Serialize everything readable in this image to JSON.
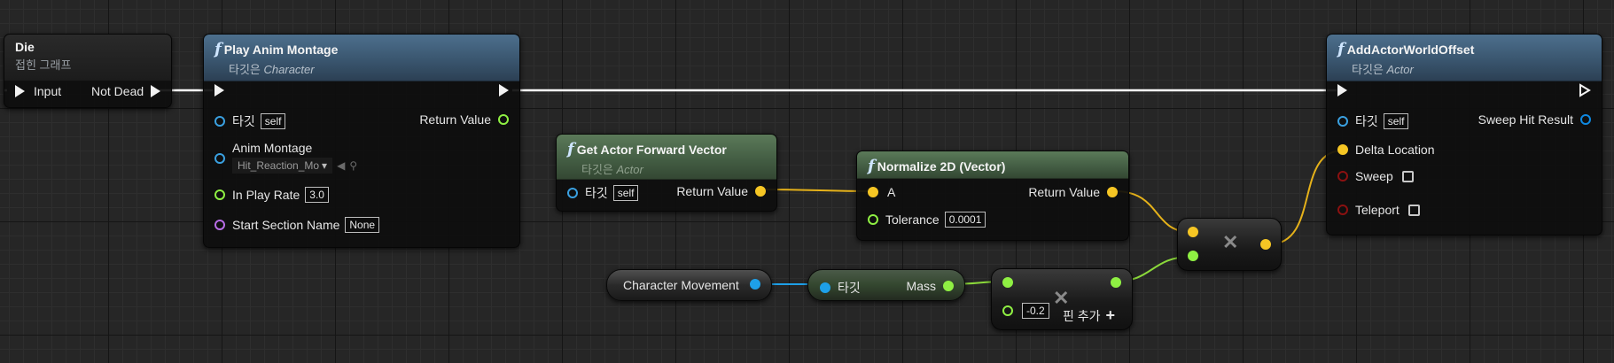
{
  "colors": {
    "exec": "#f2f2f2",
    "object_pin": "#3aa0e0",
    "vector_pin": "#f6c624",
    "float_pin": "#8ff043",
    "struct_pin": "#0f88e0",
    "name_pin": "#b86de6",
    "bool_pin": "#8b1111",
    "vector_wire": "#e6b21a",
    "float_wire": "#8bd93a",
    "object_wire": "#1ea0e8",
    "exec_wire": "#ffffff"
  },
  "icons": {
    "function": "function-icon",
    "multiply": "multiply-icon",
    "add_pin": "plus-icon"
  },
  "die_node": {
    "title": "Die",
    "subtitle": "접힌 그래프",
    "input_label": "Input",
    "output_label": "Not Dead"
  },
  "play_anim": {
    "title": "Play Anim Montage",
    "subtitle_prefix": "타깃은",
    "subtitle_class": "Character",
    "target_label": "타깃",
    "target_value": "self",
    "return_label": "Return Value",
    "montage_label": "Anim Montage",
    "montage_value": "Hit_Reaction_Mo",
    "rate_label": "In Play Rate",
    "rate_value": "3.0",
    "section_label": "Start Section Name",
    "section_value": "None"
  },
  "forward_vector": {
    "title": "Get Actor Forward Vector",
    "subtitle_prefix": "타깃은",
    "subtitle_class": "Actor",
    "target_label": "타깃",
    "target_value": "self",
    "return_label": "Return Value"
  },
  "normalize": {
    "title": "Normalize 2D (Vector)",
    "a_label": "A",
    "return_label": "Return Value",
    "tolerance_label": "Tolerance",
    "tolerance_value": "0.0001"
  },
  "add_offset": {
    "title": "AddActorWorldOffset",
    "subtitle_prefix": "타깃은",
    "subtitle_class": "Actor",
    "target_label": "타깃",
    "target_value": "self",
    "sweep_hit_label": "Sweep Hit Result",
    "delta_label": "Delta Location",
    "sweep_label": "Sweep",
    "teleport_label": "Teleport"
  },
  "char_movement": {
    "label": "Character Movement"
  },
  "get_mass": {
    "target_label": "타깃",
    "mass_label": "Mass"
  },
  "float_mul": {
    "value": "-0.2",
    "add_pin_label": "핀 추가"
  }
}
